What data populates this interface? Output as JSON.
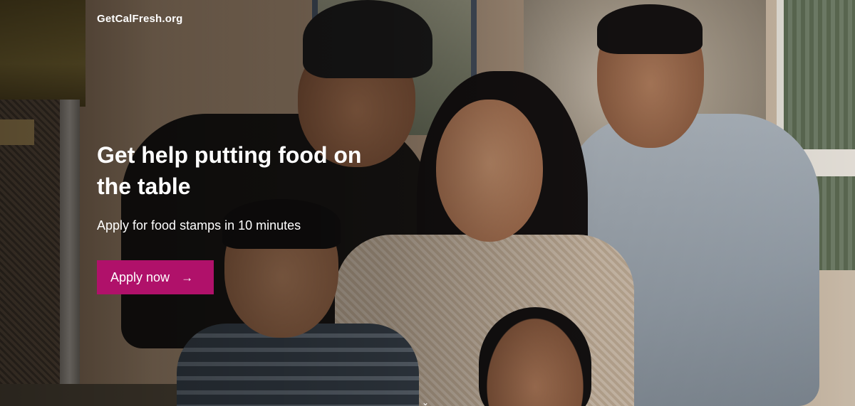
{
  "site": {
    "name": "GetCalFresh.org"
  },
  "hero": {
    "headline": "Get help putting food on the table",
    "subhead": "Apply for food stamps in 10 minutes",
    "cta_label": "Apply now",
    "cta_icon": "arrow-right-icon",
    "cta_color": "#b0116a",
    "scroll_icon": "chevron-down-icon"
  }
}
